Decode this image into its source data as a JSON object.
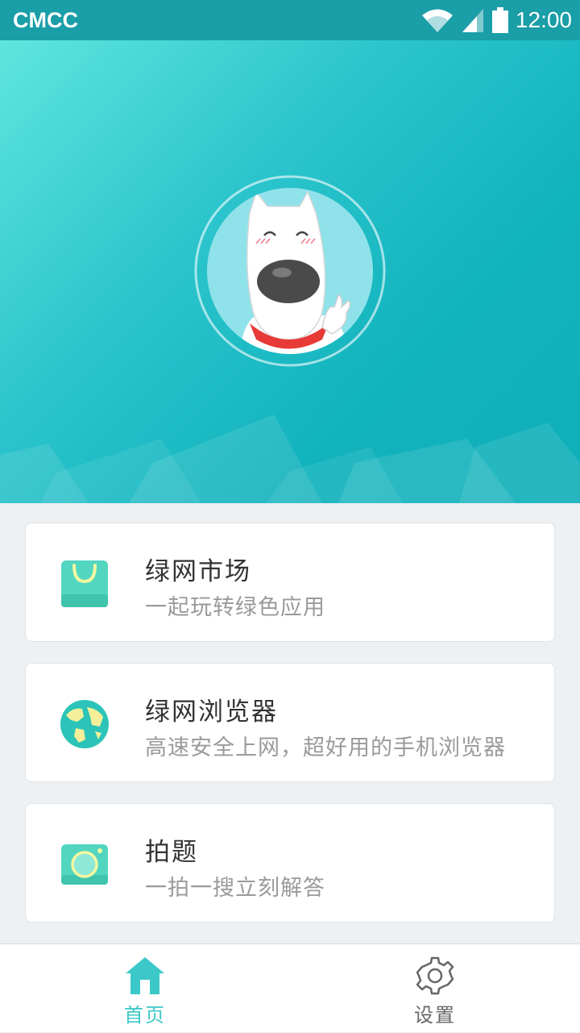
{
  "status_bar": {
    "carrier": "CMCC",
    "time": "12:00"
  },
  "hero": {
    "avatar": "mascot-dog-avatar"
  },
  "cards": [
    {
      "title": "绿网市场",
      "subtitle": "一起玩转绿色应用",
      "icon": "shopping-bag-icon"
    },
    {
      "title": "绿网浏览器",
      "subtitle": "高速安全上网，超好用的手机浏览器",
      "icon": "globe-icon"
    },
    {
      "title": "拍题",
      "subtitle": "一拍一搜立刻解答",
      "icon": "camera-icon"
    }
  ],
  "tabs": [
    {
      "label": "首页",
      "icon": "home-icon",
      "active": true
    },
    {
      "label": "设置",
      "icon": "gear-icon",
      "active": false
    }
  ],
  "colors": {
    "accent": "#3cc8c8",
    "status_bar": "#1a9ea8",
    "hero_start": "#5ee6dd",
    "hero_end": "#10afb9",
    "inactive_tab": "#666666"
  }
}
